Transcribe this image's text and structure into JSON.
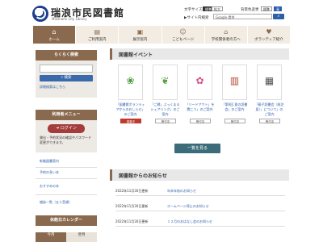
{
  "header": {
    "site_title": "瑞浪市民図書館",
    "site_sub": "Mizunami City Library",
    "text_size_label": "文字サイズ",
    "text_size_standard": "標準",
    "text_size_large": "拡大",
    "color_label": "背景色変更",
    "color_standard": "標準",
    "color_alt": "青",
    "sitemap": "▶サイト内検索",
    "search_placeholder": "Google 提供",
    "search_btn": "検索"
  },
  "nav": [
    {
      "label": "ホーム",
      "icon": "home-icon",
      "glyph": "⌂"
    },
    {
      "label": "ご利用案内",
      "icon": "guide-icon",
      "glyph": "▤"
    },
    {
      "label": "展示案内",
      "icon": "exhibit-icon",
      "glyph": "▣"
    },
    {
      "label": "こどもページ",
      "icon": "kids-icon",
      "glyph": "☺"
    },
    {
      "label": "学校関係者の方へ",
      "icon": "school-icon",
      "glyph": "⌂"
    },
    {
      "label": "ボランティア紹介",
      "icon": "volunteer-icon",
      "glyph": "♥"
    }
  ],
  "sidebar": {
    "search_head": "らくらく検索",
    "search_btn": "検索",
    "adv_link": "詳細検索はこちら",
    "menu_head": "利用者メニュー",
    "login_btn": "ログイン",
    "login_note": "貸出・予約状況の確認やパスワード変更ができます。",
    "links": [
      "新着図書案内",
      "予約の多い本",
      "おすすめの本",
      "雑誌一覧（五十音順）"
    ],
    "calendar_head": "休館日カレンダー",
    "cal_tabs": [
      "今月",
      "翌月"
    ]
  },
  "events": {
    "heading": "図書館イベント",
    "items": [
      {
        "title": "「図書館ボランティアからのおしらせ」のご案内",
        "badge": "募集中",
        "icon": "wreath-icon",
        "glyph": "❀",
        "color": "#4a9a3a"
      },
      {
        "title": "「ご縁」ぶっくまるシェアリング」のご案内",
        "badge": "受付中",
        "icon": "leaf-icon",
        "glyph": "❦",
        "color": "#5a9e44"
      },
      {
        "title": "「リードアウト」を聞こう」のご案内",
        "badge": "受付中",
        "icon": "flower-icon",
        "glyph": "✿",
        "color": "#d3508a"
      },
      {
        "title": "「第8回 夏の読書会」のご案内",
        "badge": "受付中",
        "icon": "book-icon",
        "glyph": "▥",
        "color": "#b3472f"
      },
      {
        "title": "「親子読書会（紙芝居）」について」のご案内",
        "badge": "受付中",
        "icon": "classroom-icon",
        "glyph": "▦",
        "color": "#555555"
      }
    ],
    "more_btn": "一覧を見る"
  },
  "news": {
    "heading": "図書館からのお知らせ",
    "items": [
      {
        "date": "2022年11月30日更新",
        "title": "年末年始のお知らせ"
      },
      {
        "date": "2022年11月30日更新",
        "title": "ホームページ停止のお知らせ"
      },
      {
        "date": "2022年11月30日更新",
        "title": "１２月のおはなし会のお知らせ"
      }
    ]
  }
}
